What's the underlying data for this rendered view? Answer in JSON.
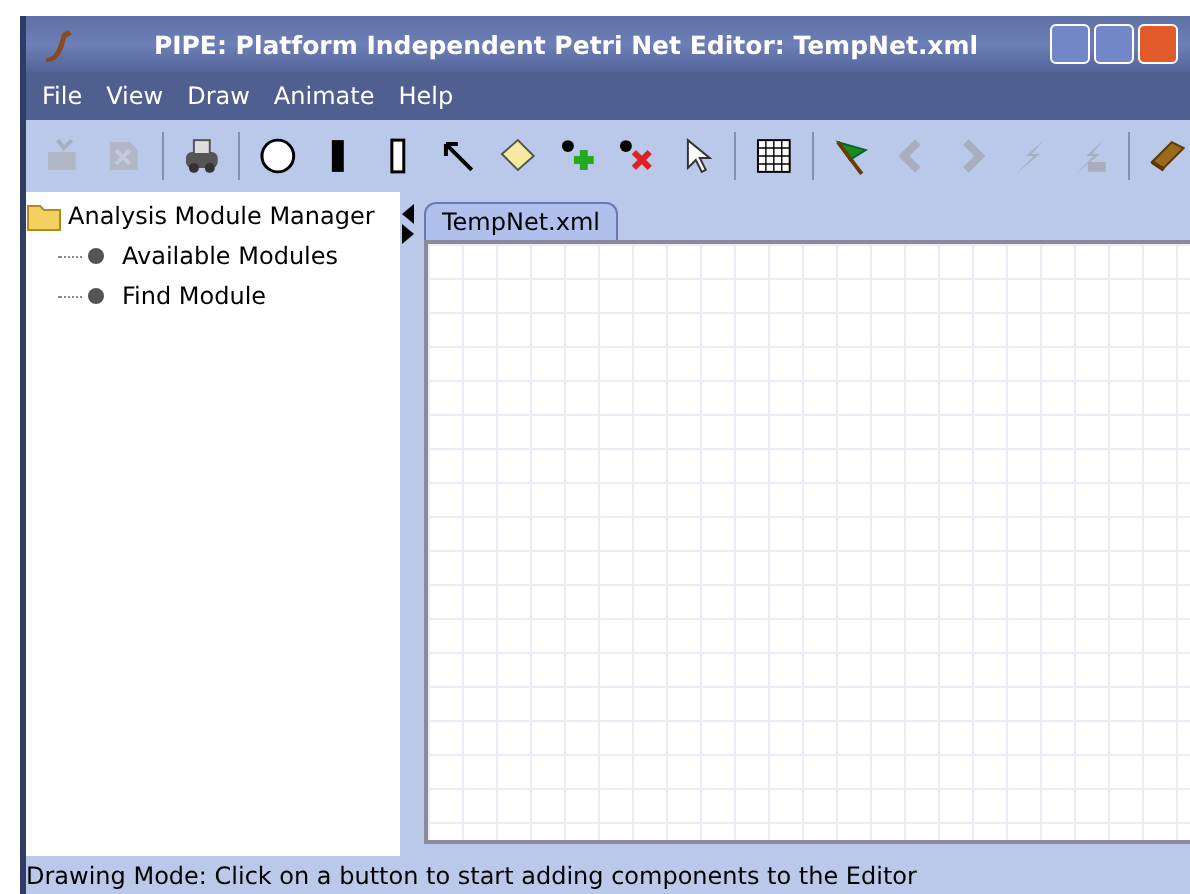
{
  "window": {
    "title": "PIPE: Platform Independent Petri Net Editor: TempNet.xml"
  },
  "menu": [
    "File",
    "View",
    "Draw",
    "Animate",
    "Help"
  ],
  "toolbar": [
    {
      "kind": "export",
      "disabled": true
    },
    {
      "kind": "close-doc",
      "disabled": true
    },
    {
      "kind": "separator"
    },
    {
      "kind": "print",
      "disabled": false
    },
    {
      "kind": "separator"
    },
    {
      "kind": "place",
      "disabled": false
    },
    {
      "kind": "transition",
      "disabled": false
    },
    {
      "kind": "timed",
      "disabled": false
    },
    {
      "kind": "arc",
      "disabled": false
    },
    {
      "kind": "note",
      "disabled": false
    },
    {
      "kind": "addtoken",
      "disabled": false
    },
    {
      "kind": "deltoken",
      "disabled": false
    },
    {
      "kind": "select",
      "disabled": false
    },
    {
      "kind": "separator"
    },
    {
      "kind": "grid",
      "disabled": false
    },
    {
      "kind": "separator"
    },
    {
      "kind": "flag",
      "disabled": false
    },
    {
      "kind": "back",
      "disabled": true
    },
    {
      "kind": "forward",
      "disabled": true
    },
    {
      "kind": "bolt",
      "disabled": true
    },
    {
      "kind": "bolts",
      "disabled": true
    },
    {
      "kind": "separator"
    },
    {
      "kind": "book",
      "disabled": false
    }
  ],
  "tree": {
    "label": "Analysis Module Manager",
    "children": [
      {
        "label": "Available Modules"
      },
      {
        "label": "Find Module"
      }
    ]
  },
  "tabs": [
    {
      "label": "TempNet.xml",
      "selected": true
    }
  ],
  "status_bar": "Drawing Mode: Click on a button to start adding components to the Editor"
}
